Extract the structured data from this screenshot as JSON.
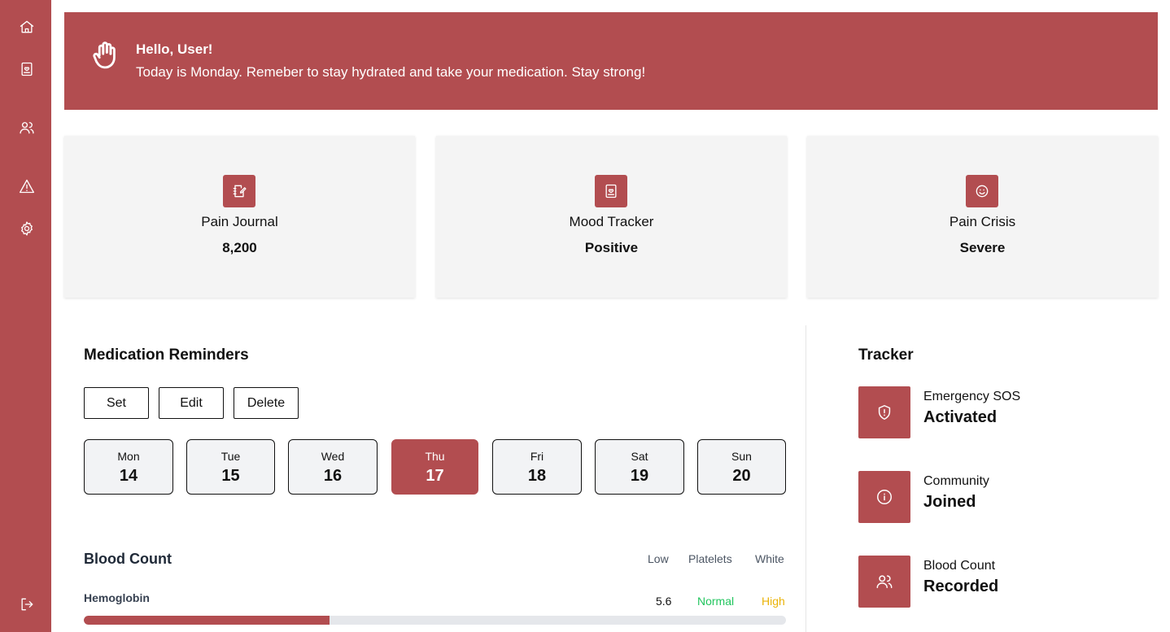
{
  "colors": {
    "accent": "#b24d50",
    "normal": "#22c55e",
    "high": "#eab308"
  },
  "sidebar": {
    "icons": [
      "home-icon",
      "journal-icon",
      "users-icon",
      "alert-icon",
      "settings-icon",
      "logout-icon"
    ]
  },
  "banner": {
    "title": "Hello, User!",
    "message": "Today is Monday. Remeber to stay hydrated and take your medication. Stay strong!"
  },
  "stats": [
    {
      "label": "Pain Journal",
      "value": "8,200",
      "icon": "edit-note-icon"
    },
    {
      "label": "Mood Tracker",
      "value": "Positive",
      "icon": "journal-icon"
    },
    {
      "label": "Pain Crisis",
      "value": "Severe",
      "icon": "smile-icon"
    }
  ],
  "reminders": {
    "title": "Medication Reminders",
    "buttons": {
      "set": "Set",
      "edit": "Edit",
      "delete": "Delete"
    },
    "days": [
      {
        "name": "Mon",
        "num": "14",
        "active": false
      },
      {
        "name": "Tue",
        "num": "15",
        "active": false
      },
      {
        "name": "Wed",
        "num": "16",
        "active": false
      },
      {
        "name": "Thu",
        "num": "17",
        "active": true
      },
      {
        "name": "Fri",
        "num": "18",
        "active": false
      },
      {
        "name": "Sat",
        "num": "19",
        "active": false
      },
      {
        "name": "Sun",
        "num": "20",
        "active": false
      }
    ]
  },
  "blood_count": {
    "title": "Blood Count",
    "headers": {
      "low": "Low",
      "platelets": "Platelets",
      "white": "White"
    },
    "row": {
      "label": "Hemoglobin",
      "value": "5.6",
      "status_normal": "Normal",
      "status_high": "High",
      "progress": 0.35
    }
  },
  "tracker": {
    "title": "Tracker",
    "items": [
      {
        "label": "Emergency SOS",
        "value": "Activated",
        "icon": "shield-alert-icon"
      },
      {
        "label": "Community",
        "value": "Joined",
        "icon": "info-icon"
      },
      {
        "label": "Blood Count",
        "value": "Recorded",
        "icon": "users-icon"
      }
    ]
  }
}
